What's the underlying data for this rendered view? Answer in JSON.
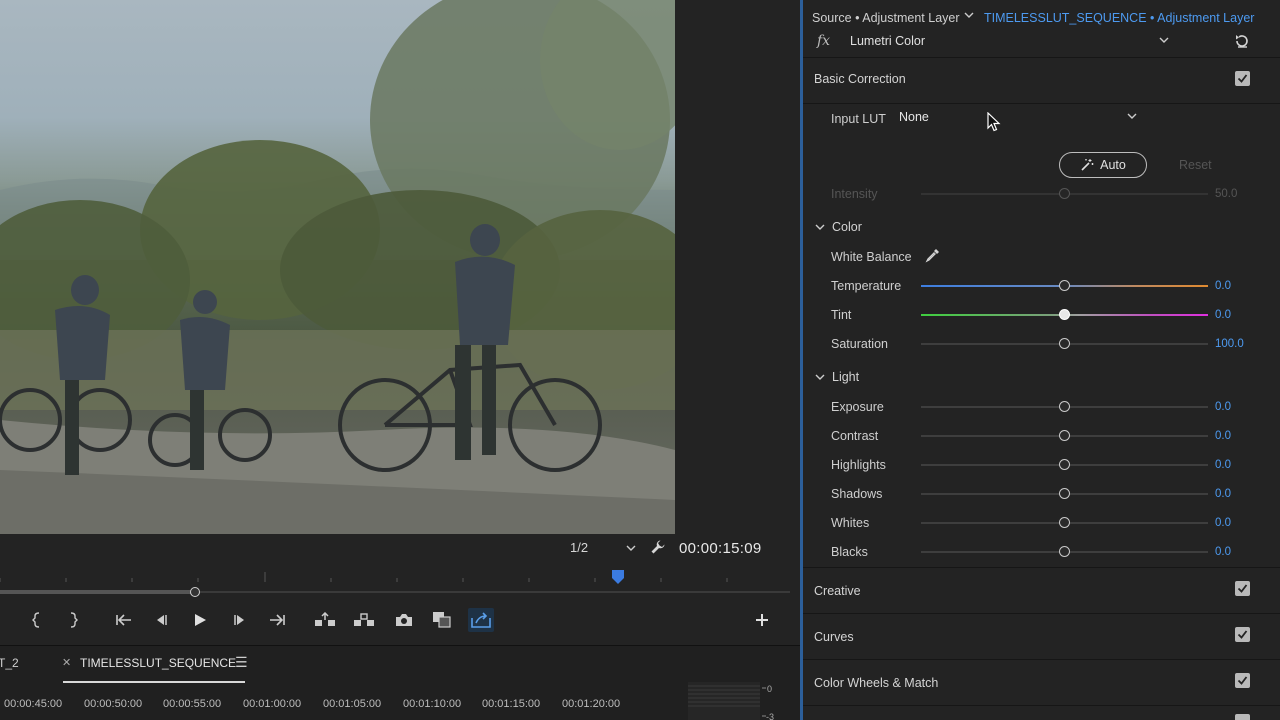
{
  "monitor": {
    "zoom": "1/2",
    "timecode": "00:00:15:09"
  },
  "timeline": {
    "tab_prev": "T_2",
    "tab_active": "TIMELESSLUT_SEQUENCE",
    "ruler_labels": [
      "00:00:45:00",
      "00:00:50:00",
      "00:00:55:00",
      "00:01:00:00",
      "00:01:05:00",
      "00:01:10:00",
      "00:01:15:00",
      "00:01:20:00"
    ],
    "meter_labels": [
      "0",
      "-3"
    ]
  },
  "lumetri": {
    "source": "Source • Adjustment Layer",
    "sequence": "TIMELESSLUT_SEQUENCE • Adjustment Layer",
    "fx": "fx",
    "effect": "Lumetri Color",
    "basic_correction": {
      "title": "Basic Correction",
      "input_lut_label": "Input LUT",
      "input_lut_value": "None",
      "auto_label": "Auto",
      "reset_label": "Reset",
      "intensity": {
        "label": "Intensity",
        "value": "50.0",
        "position": 0.5
      }
    },
    "color": {
      "title": "Color",
      "white_balance": "White Balance",
      "sliders": [
        {
          "label": "Temperature",
          "value": "0.0",
          "position": 0.5
        },
        {
          "label": "Tint",
          "value": "0.0",
          "position": 0.5
        },
        {
          "label": "Saturation",
          "value": "100.0",
          "position": 0.5
        }
      ]
    },
    "light": {
      "title": "Light",
      "sliders": [
        {
          "label": "Exposure",
          "value": "0.0",
          "position": 0.5
        },
        {
          "label": "Contrast",
          "value": "0.0",
          "position": 0.5
        },
        {
          "label": "Highlights",
          "value": "0.0",
          "position": 0.5
        },
        {
          "label": "Shadows",
          "value": "0.0",
          "position": 0.5
        },
        {
          "label": "Whites",
          "value": "0.0",
          "position": 0.5
        },
        {
          "label": "Blacks",
          "value": "0.0",
          "position": 0.5
        }
      ]
    },
    "sections": [
      "Creative",
      "Curves",
      "Color Wheels & Match"
    ]
  },
  "colors": {
    "accent": "#4d9af0",
    "panel_divider": "#2c5f9a"
  }
}
